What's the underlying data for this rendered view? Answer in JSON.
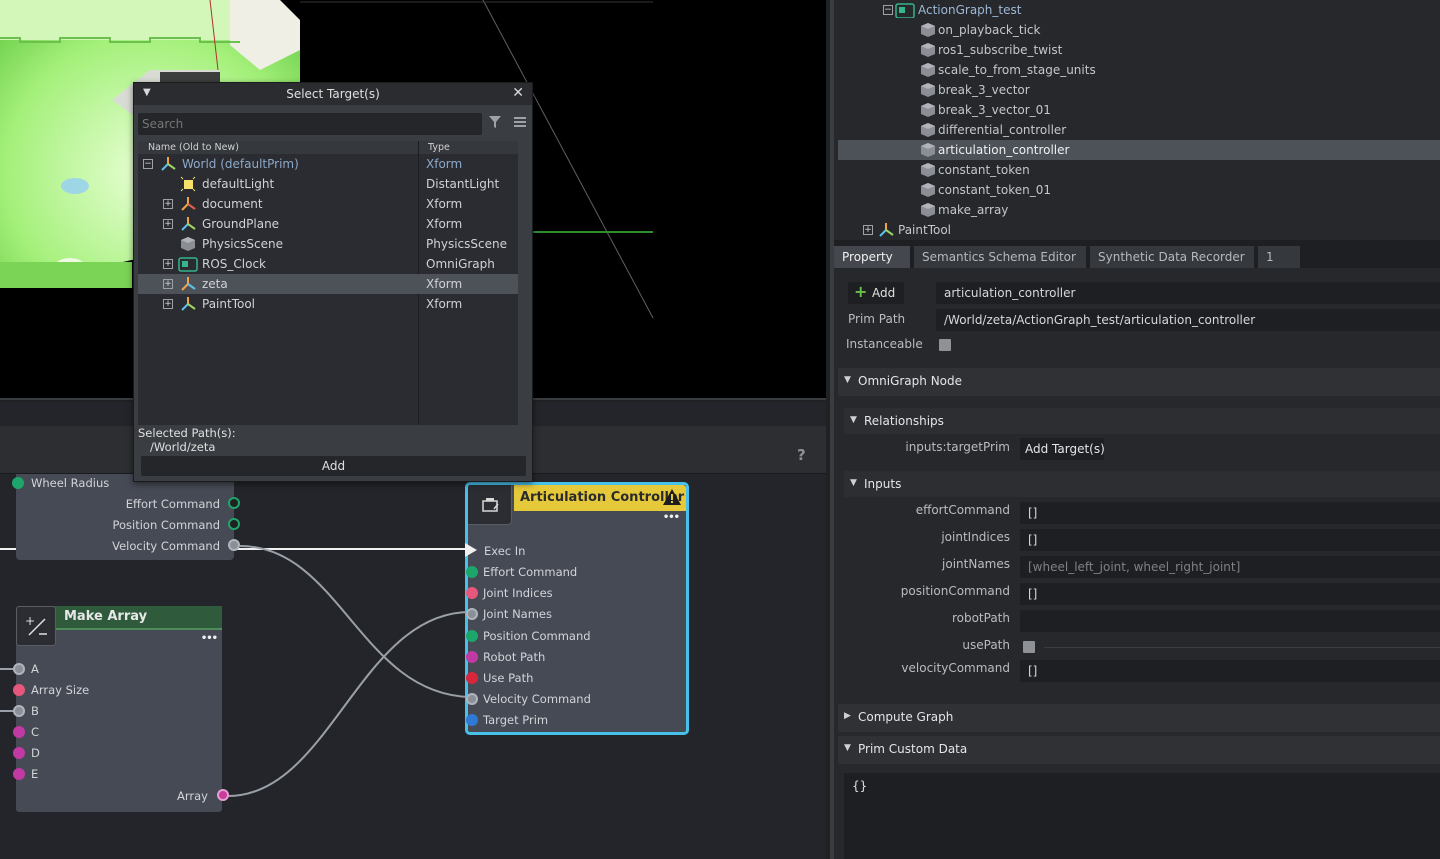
{
  "dialog": {
    "title": "Select Target(s)",
    "search_placeholder": "Search",
    "col_name": "Name (Old to New)",
    "col_type": "Type",
    "rows": [
      {
        "name": "World (defaultPrim)",
        "type": "Xform"
      },
      {
        "name": "defaultLight",
        "type": "DistantLight"
      },
      {
        "name": "document",
        "type": "Xform"
      },
      {
        "name": "GroundPlane",
        "type": "Xform"
      },
      {
        "name": "PhysicsScene",
        "type": "PhysicsScene"
      },
      {
        "name": "ROS_Clock",
        "type": "OmniGraph"
      },
      {
        "name": "zeta",
        "type": "Xform"
      },
      {
        "name": "PaintTool",
        "type": "Xform"
      }
    ],
    "selected_label": "Selected Path(s):",
    "selected_path": "/World/zeta",
    "add_label": "Add",
    "collapse_glyph": "▼",
    "close_glyph": "✕"
  },
  "graph": {
    "help": "?",
    "diff_node": {
      "wheel_radius": "Wheel Radius",
      "effort": "Effort Command",
      "position": "Position Command",
      "velocity": "Velocity Command"
    },
    "artic_node": {
      "title": "Articulation Controller",
      "ports": [
        "Exec In",
        "Effort Command",
        "Joint Indices",
        "Joint Names",
        "Position Command",
        "Robot Path",
        "Use Path",
        "Velocity Command",
        "Target Prim"
      ]
    },
    "make_node": {
      "title": "Make Array",
      "ports": [
        "A",
        "Array Size",
        "B",
        "C",
        "D",
        "E"
      ],
      "output": "Array"
    },
    "dots": "•••"
  },
  "stage": {
    "root": "ActionGraph_test",
    "items": [
      "on_playback_tick",
      "ros1_subscribe_twist",
      "scale_to_from_stage_units",
      "break_3_vector",
      "break_3_vector_01",
      "differential_controller",
      "articulation_controller",
      "constant_token",
      "constant_token_01",
      "make_array"
    ],
    "sibling": "PaintTool"
  },
  "property": {
    "tabs": [
      "Property",
      "Semantics Schema Editor",
      "Synthetic Data Recorder",
      "1"
    ],
    "add_label": "Add",
    "add_icon": "+",
    "name_value": "articulation_controller",
    "prim_path_label": "Prim Path",
    "prim_path_value": "/World/zeta/ActionGraph_test/articulation_controller",
    "instanceable_label": "Instanceable",
    "sections": {
      "omnigraph_node": "OmniGraph Node",
      "relationships": "Relationships",
      "inputs": "Inputs",
      "compute_graph": "Compute Graph",
      "prim_custom_data": "Prim Custom Data"
    },
    "target_prim_label": "inputs:targetPrim",
    "add_target_label": "Add Target(s)",
    "inputs": [
      {
        "label": "effortCommand",
        "value": "[]"
      },
      {
        "label": "jointIndices",
        "value": "[]"
      },
      {
        "label": "jointNames",
        "value": "[wheel_left_joint, wheel_right_joint]"
      },
      {
        "label": "positionCommand",
        "value": "[]"
      },
      {
        "label": "robotPath",
        "value": ""
      },
      {
        "label": "usePath",
        "value": ""
      },
      {
        "label": "velocityCommand",
        "value": "[]"
      }
    ],
    "custom_data_value": "{}",
    "caret_open": "▼",
    "caret_closed": "▶"
  },
  "colors": {
    "accent": "#47c1ea",
    "warning_title": "#e5c93b",
    "make_array_title": "#2f5a3b"
  }
}
